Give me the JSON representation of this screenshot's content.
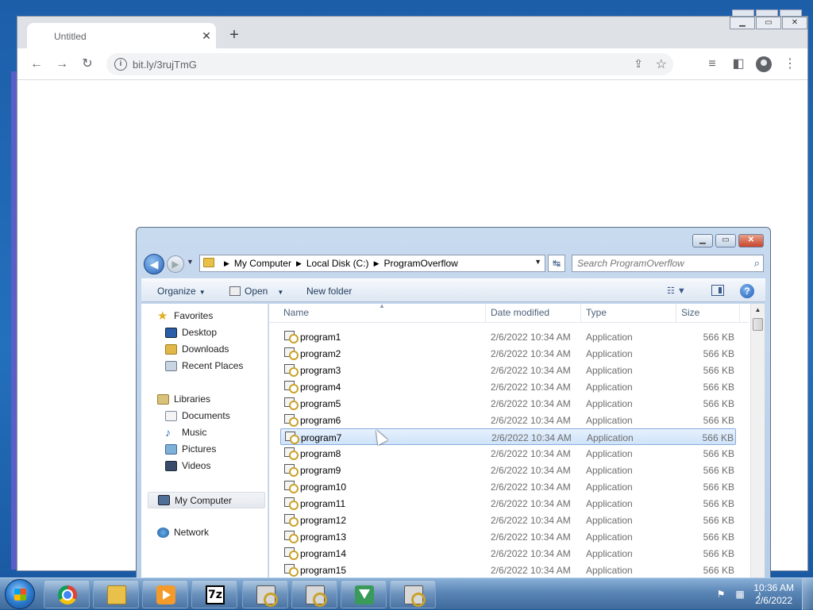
{
  "browser": {
    "tab_title": "Untitled",
    "tab_close": "✕",
    "new_tab": "+",
    "url": "bit.ly/3rujTmG"
  },
  "explorer": {
    "breadcrumb": [
      "My Computer",
      "Local Disk (C:)",
      "ProgramOverflow"
    ],
    "search_placeholder": "Search ProgramOverflow",
    "commands": {
      "organize": "Organize",
      "open": "Open",
      "new_folder": "New folder"
    },
    "columns": [
      "Name",
      "Date modified",
      "Type",
      "Size"
    ],
    "nav": {
      "favorites": "Favorites",
      "desktop": "Desktop",
      "downloads": "Downloads",
      "recent_places": "Recent Places",
      "libraries": "Libraries",
      "documents": "Documents",
      "music": "Music",
      "pictures": "Pictures",
      "videos": "Videos",
      "my_computer": "My Computer",
      "network": "Network"
    },
    "selected_row": 6,
    "files": [
      {
        "name": "program1",
        "date": "2/6/2022 10:34 AM",
        "type": "Application",
        "size": "566 KB"
      },
      {
        "name": "program2",
        "date": "2/6/2022 10:34 AM",
        "type": "Application",
        "size": "566 KB"
      },
      {
        "name": "program3",
        "date": "2/6/2022 10:34 AM",
        "type": "Application",
        "size": "566 KB"
      },
      {
        "name": "program4",
        "date": "2/6/2022 10:34 AM",
        "type": "Application",
        "size": "566 KB"
      },
      {
        "name": "program5",
        "date": "2/6/2022 10:34 AM",
        "type": "Application",
        "size": "566 KB"
      },
      {
        "name": "program6",
        "date": "2/6/2022 10:34 AM",
        "type": "Application",
        "size": "566 KB"
      },
      {
        "name": "program7",
        "date": "2/6/2022 10:34 AM",
        "type": "Application",
        "size": "566 KB"
      },
      {
        "name": "program8",
        "date": "2/6/2022 10:34 AM",
        "type": "Application",
        "size": "566 KB"
      },
      {
        "name": "program9",
        "date": "2/6/2022 10:34 AM",
        "type": "Application",
        "size": "566 KB"
      },
      {
        "name": "program10",
        "date": "2/6/2022 10:34 AM",
        "type": "Application",
        "size": "566 KB"
      },
      {
        "name": "program11",
        "date": "2/6/2022 10:34 AM",
        "type": "Application",
        "size": "566 KB"
      },
      {
        "name": "program12",
        "date": "2/6/2022 10:34 AM",
        "type": "Application",
        "size": "566 KB"
      },
      {
        "name": "program13",
        "date": "2/6/2022 10:34 AM",
        "type": "Application",
        "size": "566 KB"
      },
      {
        "name": "program14",
        "date": "2/6/2022 10:34 AM",
        "type": "Application",
        "size": "566 KB"
      },
      {
        "name": "program15",
        "date": "2/6/2022 10:34 AM",
        "type": "Application",
        "size": "566 KB"
      }
    ]
  },
  "taskbar": {
    "apps": [
      "chrome-icon",
      "explorer-folder-icon",
      "media-player-icon",
      "7zip-icon",
      "program-icon",
      "program-icon",
      "download-icon",
      "installer-icon"
    ],
    "seven_zip_label": "7z",
    "time": "10:36 AM",
    "date": "2/6/2022"
  }
}
